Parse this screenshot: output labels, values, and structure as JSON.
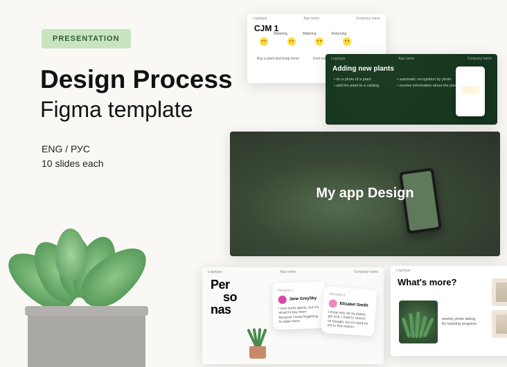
{
  "badge": "PRESENTATION",
  "title": "Design Process",
  "subtitle": "Figma template",
  "meta_line1": "ENG / РУС",
  "meta_line2": "10 slides each",
  "slides": {
    "header_logo": "Logotype",
    "header_app": "App name",
    "header_company": "Company name",
    "cjm": {
      "title": "CJM 1",
      "steps": [
        "Watering",
        "Watering",
        "Returning"
      ],
      "bottom1": "Buy a plant and bring home",
      "bottom2": "Find out information about the plant"
    },
    "adding": {
      "title": "Adding new plants",
      "list_left": [
        "• do a photo of a plant",
        "• add the plant to a catalog"
      ],
      "list_right": [
        "• automatic recognition by photo",
        "• receive information about the plant care"
      ]
    },
    "main": {
      "title": "My app Design"
    },
    "personas": {
      "title_l1": "Per",
      "title_l2": "so",
      "title_l3": "nas",
      "card1": {
        "head": "Persona 1",
        "name": "Jane GreySky",
        "quote": "I love home plants, but I'm afraid to buy them because I keep forgetting to water them"
      },
      "card2": {
        "head": "Persona 2",
        "name": "Elizabet Smith",
        "quote": "I know why all my plants get sick. I tried to search on Google, but it's hard for me to find reason"
      }
    },
    "more": {
      "title": "What's more?",
      "text": "weekly photo taking for tracking progress"
    }
  }
}
